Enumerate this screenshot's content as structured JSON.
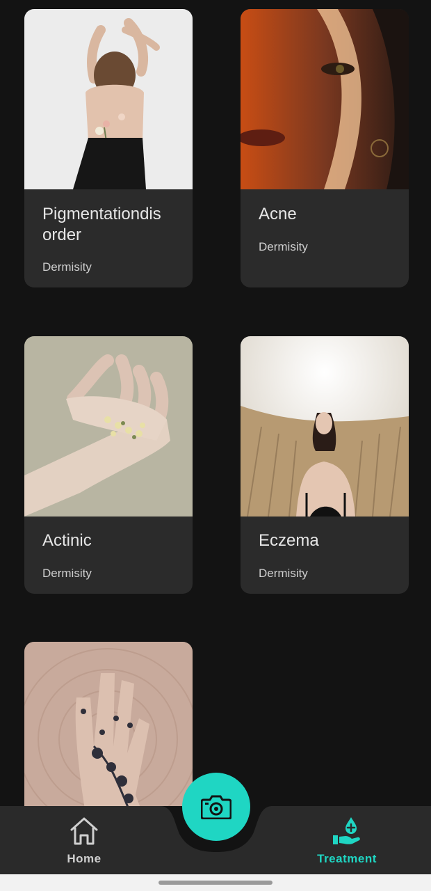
{
  "cards": [
    {
      "title": "Pigmentationdis order",
      "subtitle": "Dermisity"
    },
    {
      "title": "Acne",
      "subtitle": "Dermisity"
    },
    {
      "title": "Actinic",
      "subtitle": "Dermisity"
    },
    {
      "title": "Eczema",
      "subtitle": "Dermisity"
    },
    {
      "title": "",
      "subtitle": ""
    }
  ],
  "nav": {
    "home_label": "Home",
    "treatment_label": "Treatment",
    "home_icon": "home-icon",
    "camera_icon": "camera-icon",
    "treatment_icon": "hand-drop-plus-icon"
  },
  "colors": {
    "background": "#131313",
    "card": "#2b2b2b",
    "accent": "#1fd6c3",
    "nav_bar": "#2a2a2a"
  }
}
